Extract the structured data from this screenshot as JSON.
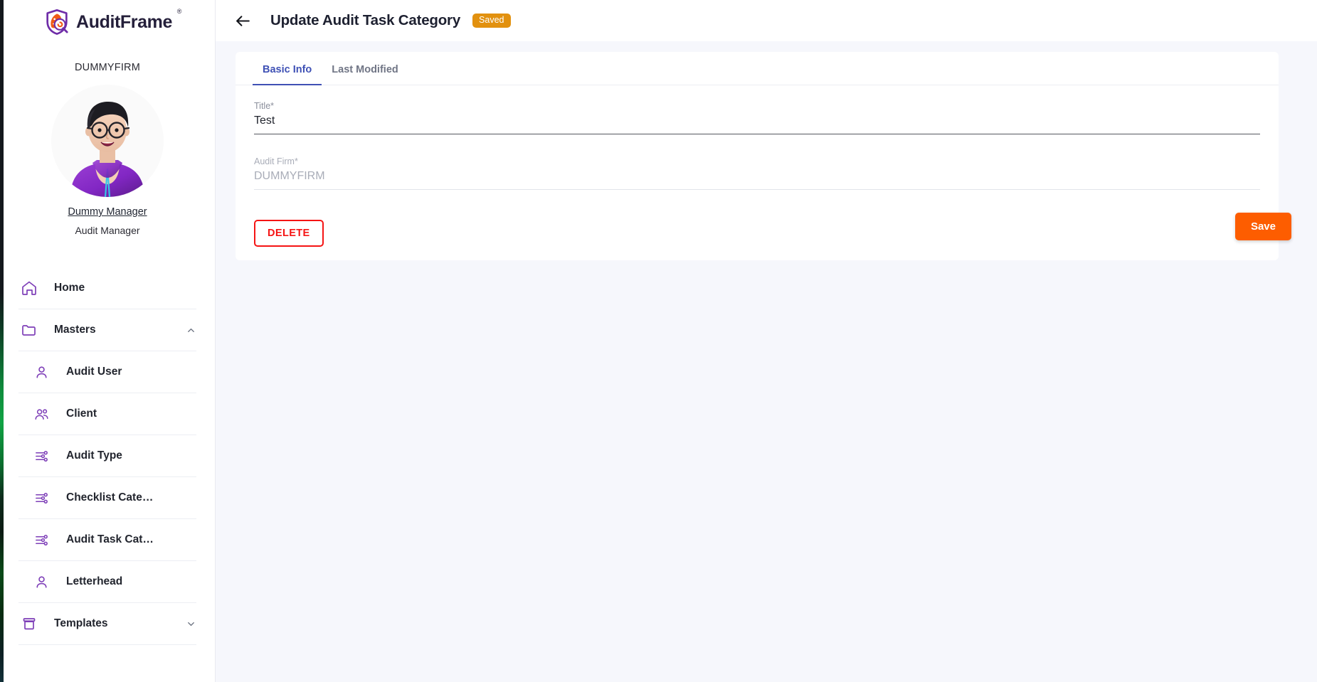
{
  "brand": {
    "name": "AuditFrame",
    "trademark": "®",
    "logo_icon": "auditframe-shield-magnifier-logo"
  },
  "sidebar": {
    "firm_name": "DUMMYFIRM",
    "avatar_icon": "user-avatar-illustration",
    "user_name": "Dummy Manager",
    "user_role": "Audit Manager",
    "items": [
      {
        "label": "Home",
        "icon": "home-icon",
        "sub": false,
        "chevron": ""
      },
      {
        "label": "Masters",
        "icon": "folder-icon",
        "sub": false,
        "chevron": "chevron-up-icon"
      },
      {
        "label": "Audit User",
        "icon": "person-icon",
        "sub": true,
        "chevron": ""
      },
      {
        "label": "Client",
        "icon": "people-icon",
        "sub": true,
        "chevron": ""
      },
      {
        "label": "Audit Type",
        "icon": "tune-sliders-icon",
        "sub": true,
        "chevron": ""
      },
      {
        "label": "Checklist Cate…",
        "icon": "tune-sliders-icon",
        "sub": true,
        "chevron": ""
      },
      {
        "label": "Audit Task Cat…",
        "icon": "tune-sliders-icon",
        "sub": true,
        "chevron": ""
      },
      {
        "label": "Letterhead",
        "icon": "person-icon",
        "sub": true,
        "chevron": ""
      },
      {
        "label": "Templates",
        "icon": "archive-box-icon",
        "sub": false,
        "chevron": "chevron-down-icon"
      }
    ]
  },
  "header": {
    "back_icon": "arrow-left-icon",
    "title": "Update Audit Task Category",
    "status_badge": "Saved"
  },
  "tabs": [
    {
      "label": "Basic Info",
      "active": true
    },
    {
      "label": "Last Modified",
      "active": false
    }
  ],
  "form": {
    "fields": [
      {
        "label": "Title*",
        "value": "Test",
        "placeholder": "Title",
        "disabled": false,
        "name": "title-field"
      },
      {
        "label": "Audit Firm*",
        "value": "DUMMYFIRM",
        "placeholder": "Audit Firm",
        "disabled": true,
        "name": "audit-firm-field"
      }
    ]
  },
  "actions": {
    "delete_label": "DELETE",
    "save_label": "Save"
  },
  "colors": {
    "accent_purple": "#7e3fb8",
    "tab_active": "#3f51b5",
    "save_orange": "#fd5d00",
    "badge_orange": "#e2910f",
    "delete_red": "#f51414",
    "page_bg": "#f6f7fc"
  }
}
